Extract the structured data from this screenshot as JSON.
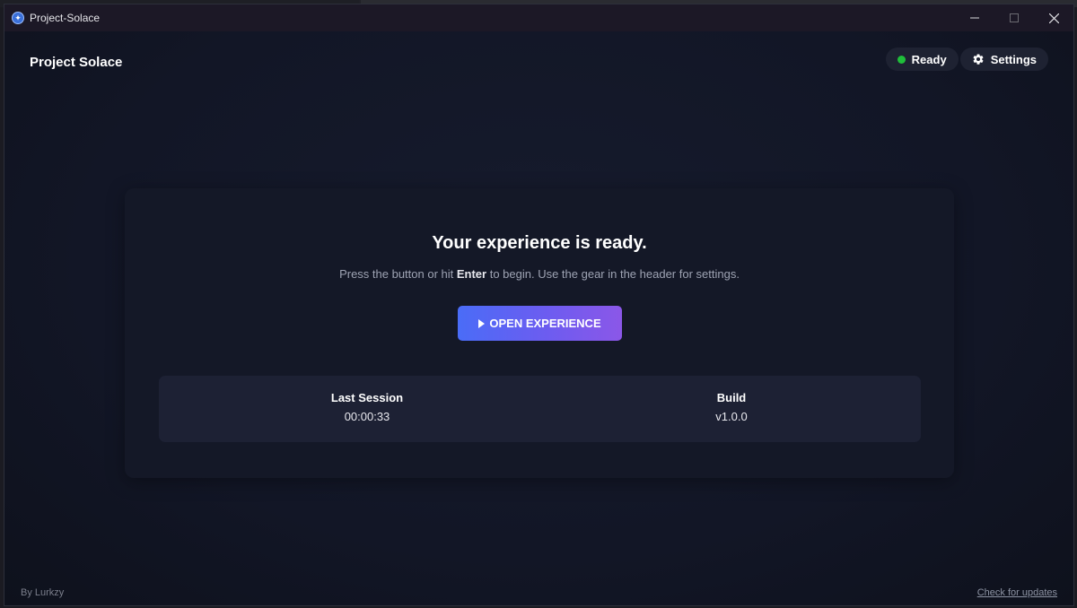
{
  "window": {
    "title": "Project-Solace"
  },
  "header": {
    "brand": "Project Solace",
    "status_label": "Ready",
    "settings_label": "Settings"
  },
  "main": {
    "heading": "Your experience is ready.",
    "sub_before": "Press the button or hit ",
    "sub_key": "Enter",
    "sub_after": " to begin. Use the gear in the header for settings.",
    "open_button": "OPEN EXPERIENCE",
    "stats": [
      {
        "label": "Last Session",
        "value": "00:00:33"
      },
      {
        "label": "Build",
        "value": "v1.0.0"
      }
    ]
  },
  "footer": {
    "credit": "By Lurkzy",
    "update_link": "Check for updates"
  },
  "colors": {
    "status_dot": "#1fbf3a",
    "button_gradient_start": "#4a6cf7",
    "button_gradient_end": "#8b57e8"
  },
  "icons": {
    "app": "app-logo-icon",
    "settings": "gear-icon",
    "play": "play-icon"
  }
}
